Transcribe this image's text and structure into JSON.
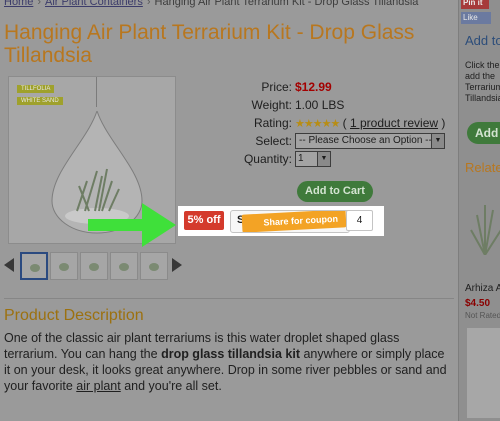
{
  "breadcrumb": {
    "home": "Home",
    "category": "Air Plant Containers",
    "current": "Hanging Air Plant Terrarium Kit - Drop Glass Tillandsia",
    "separator": "›"
  },
  "product": {
    "title": "Hanging Air Plant Terrarium Kit - Drop Glass Tillandsia",
    "image_labels": [
      "TILLFOLIA",
      "WHITE SAND"
    ],
    "price_label": "Price:",
    "price": "$12.99",
    "weight_label": "Weight:",
    "weight": "1.00 LBS",
    "rating_label": "Rating:",
    "rating_stars": "★★★★★",
    "rating_stars_value": 5,
    "rating_review_prefix": "(",
    "rating_review_link": "1 product review",
    "rating_review_suffix": ")",
    "select_label": "Select:",
    "select_value": "-- Please Choose an Option --",
    "quantity_label": "Quantity:",
    "quantity_value": "1",
    "add_to_cart": "Add to Cart"
  },
  "coupon_overlay": {
    "discount": "5% off",
    "share_left": "Sh",
    "share_button": "Share for coupon",
    "count": "4"
  },
  "thumbnails": {
    "count": 5,
    "active_index": 0
  },
  "description": {
    "heading": "Product Description",
    "p1": "One of the classic air plant terrariums is this water droplet shaped glass terrarium. You can hang the ",
    "bold": "drop glass tillandsia kit",
    "p2": " anywhere or simply place it on your desk, it looks great anywhere.  Drop in some river pebbles or sand and your favorite ",
    "link": "air plant",
    "p3": " and you're all set."
  },
  "sidebar": {
    "pinit": "Pin it",
    "like": "Like",
    "add_title": "Add to",
    "text_lines": [
      "Click the",
      "add the",
      "Terrarium",
      "Tillandsia"
    ],
    "add_button": "Add",
    "related_title": "Relate",
    "product_name": "Arhiza A",
    "product_price": "$4.50",
    "product_rate": "Not Rated"
  },
  "colors": {
    "title": "#b8771f",
    "price": "#a30000",
    "add_to_cart": "#3f7a3b",
    "arrow": "#3fe03a",
    "discount_badge": "#d43a2c",
    "share_tag": "#f3a325"
  }
}
